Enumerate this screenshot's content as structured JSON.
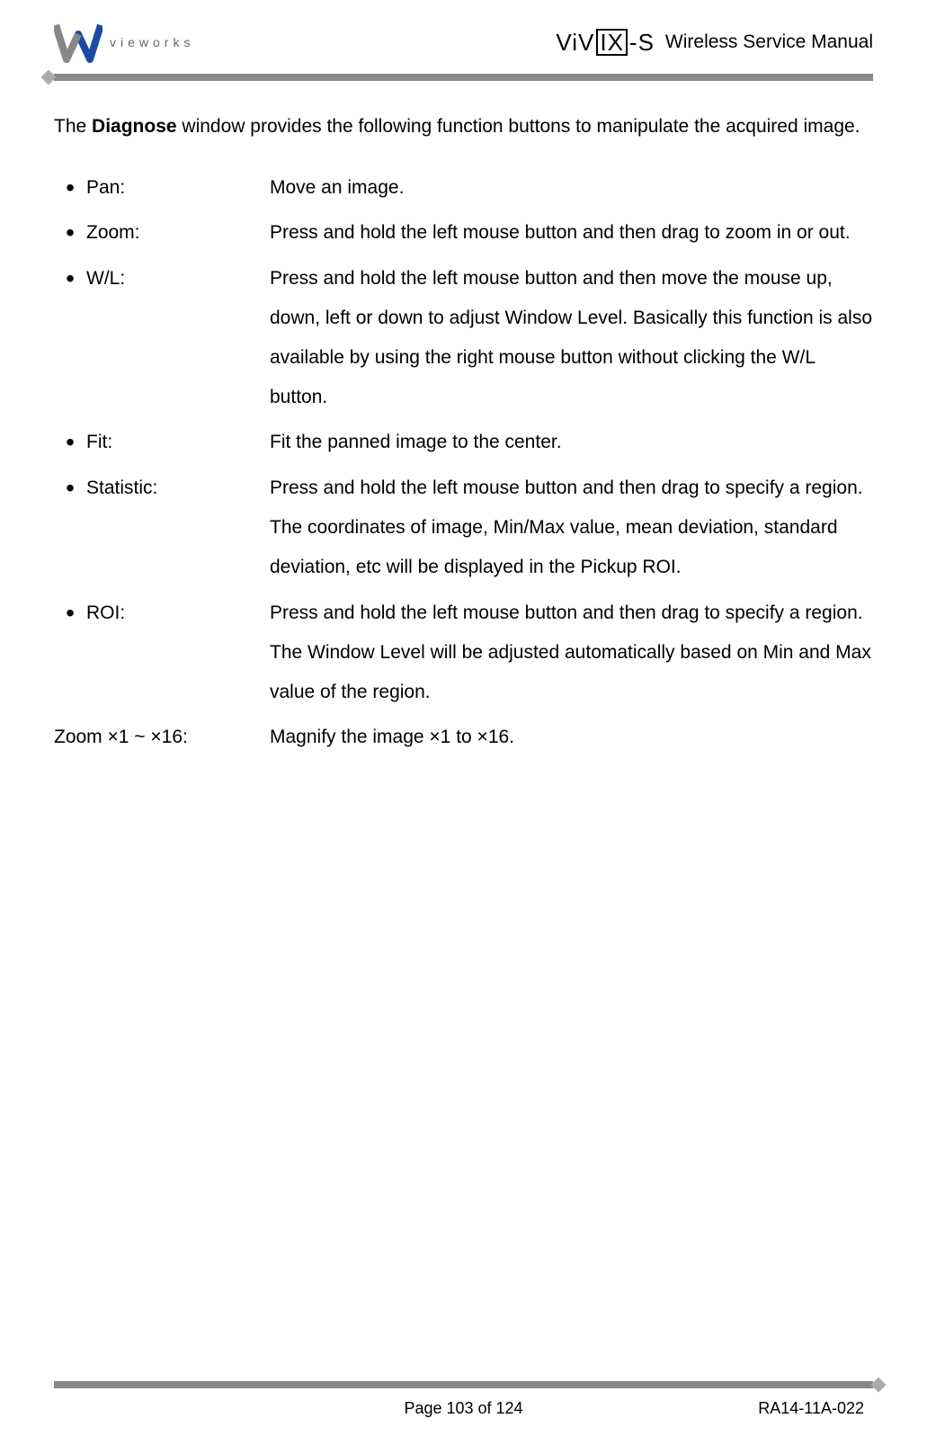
{
  "header": {
    "logo_text": "vieworks",
    "product_logo_prefix": "ViV",
    "product_logo_boxed": "IX",
    "product_logo_suffix": "-S",
    "title": "Wireless Service Manual"
  },
  "intro": {
    "prefix": "The ",
    "bold": "Diagnose",
    "suffix": " window provides the following function buttons to manipulate the acquired image."
  },
  "items": [
    {
      "label": "Pan:",
      "desc": "Move an image."
    },
    {
      "label": "Zoom:",
      "desc": "Press and hold the left mouse button and then drag to zoom in or out."
    },
    {
      "label": "W/L:",
      "desc": "Press and hold the left mouse button and then move the mouse up, down, left or down to adjust Window Level. Basically this function is also available by using the right mouse button without clicking the W/L button."
    },
    {
      "label": "Fit:",
      "desc": "Fit the panned image to the center."
    },
    {
      "label": "Statistic:",
      "desc": "Press and hold the left mouse button and then drag to specify a region. The coordinates of image, Min/Max value, mean deviation, standard deviation, etc will be displayed in the Pickup ROI."
    },
    {
      "label": "ROI:",
      "desc": "Press and hold the left mouse button and then drag to specify a region. The Window Level will be adjusted automatically based on Min and Max value of the region."
    }
  ],
  "extra": {
    "label": "Zoom ×1 ~ ×16:",
    "desc": "Magnify the image ×1 to ×16."
  },
  "footer": {
    "page": "Page 103 of 124",
    "docnum": "RA14-11A-022"
  }
}
